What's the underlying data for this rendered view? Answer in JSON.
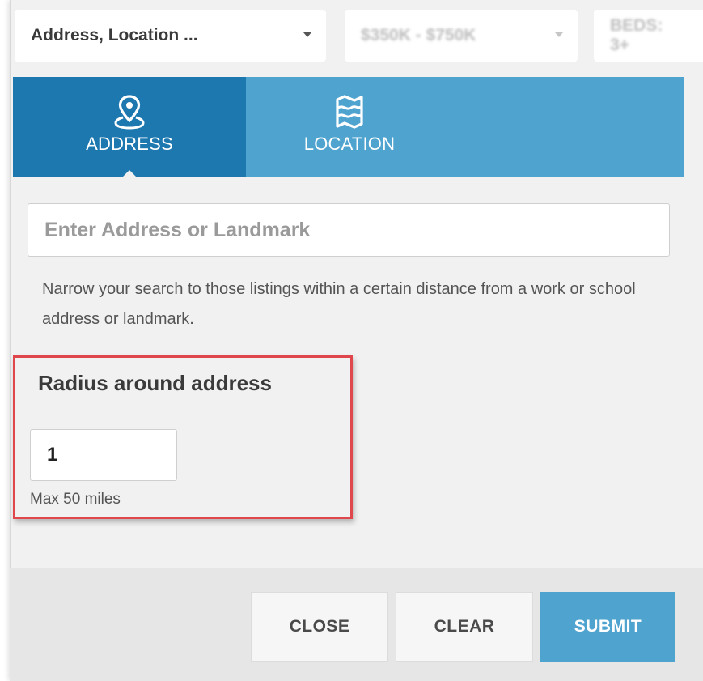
{
  "filters": {
    "location": "Address, Location ...",
    "price": "$350K - $750K",
    "beds": "BEDS: 3+"
  },
  "tabs": [
    {
      "label": "ADDRESS",
      "icon": "map-pin-icon",
      "active": true
    },
    {
      "label": "LOCATION",
      "icon": "map-icon",
      "active": false
    }
  ],
  "address": {
    "placeholder": "Enter Address or Landmark",
    "help_text": "Narrow your search to those listings within a certain distance from a work or school address or landmark."
  },
  "radius": {
    "title": "Radius around address",
    "value": "1",
    "note": "Max 50 miles"
  },
  "buttons": {
    "close": "CLOSE",
    "clear": "CLEAR",
    "submit": "SUBMIT"
  },
  "colors": {
    "tab_active": "#1d78b0",
    "tab_bar": "#4fa3cf",
    "submit": "#4fa3cf",
    "highlight_border": "#e0474c"
  }
}
